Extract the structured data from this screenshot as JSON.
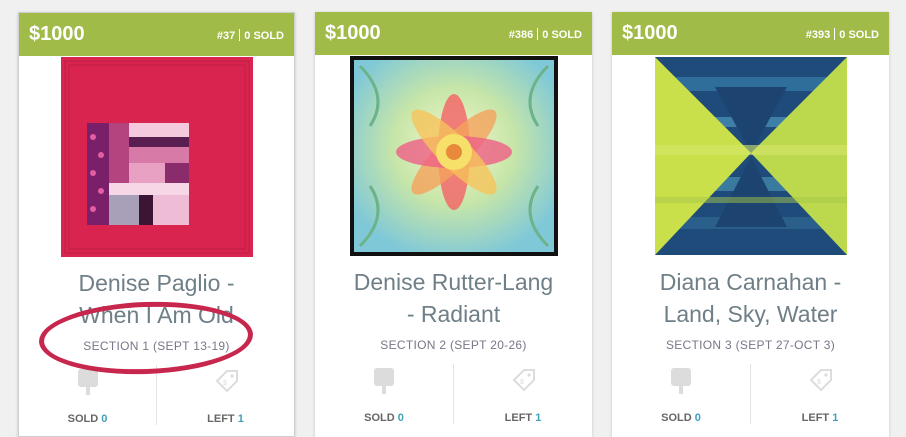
{
  "cards": [
    {
      "price": "$1000",
      "number": "#37",
      "sold_text": "0 SOLD",
      "title_line1": "Denise Paglio -",
      "title_line2": "When I Am Old",
      "section": "SECTION 1 (SEPT 13-19)",
      "stat_sold_label": "SOLD",
      "stat_sold_value": "0",
      "stat_left_label": "LEFT",
      "stat_left_value": "1"
    },
    {
      "price": "$1000",
      "number": "#386",
      "sold_text": "0 SOLD",
      "title_line1": "Denise Rutter-Lang",
      "title_line2": "- Radiant",
      "section": "SECTION 2 (SEPT 20-26)",
      "stat_sold_label": "SOLD",
      "stat_sold_value": "0",
      "stat_left_label": "LEFT",
      "stat_left_value": "1"
    },
    {
      "price": "$1000",
      "number": "#393",
      "sold_text": "0 SOLD",
      "title_line1": "Diana Carnahan -",
      "title_line2": "Land, Sky, Water",
      "section": "SECTION 3 (SEPT 27-OCT 3)",
      "stat_sold_label": "SOLD",
      "stat_sold_value": "0",
      "stat_left_label": "LEFT",
      "stat_left_value": "1"
    }
  ],
  "colors": {
    "header": "#a0bb47",
    "annotation_circle": "#c8274d",
    "count_accent": "#3fa0b8"
  }
}
